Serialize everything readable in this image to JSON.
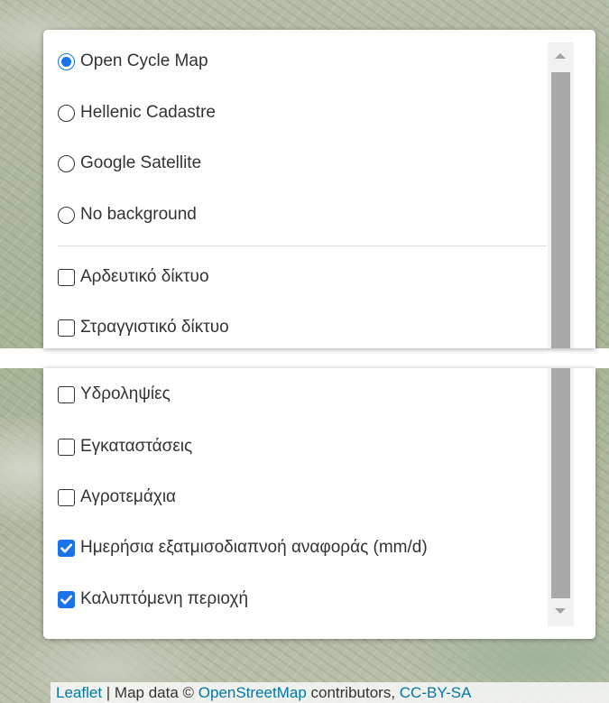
{
  "base_layers": [
    {
      "label": "Open Cycle Map",
      "checked": true
    },
    {
      "label": "Hellenic Cadastre",
      "checked": false
    },
    {
      "label": "Google Satellite",
      "checked": false
    },
    {
      "label": "No background",
      "checked": false
    }
  ],
  "overlays_top": [
    {
      "label": "Αρδευτικό δίκτυο",
      "checked": false
    },
    {
      "label": "Στραγγιστικό δίκτυο",
      "checked": false
    }
  ],
  "overlays_bottom": [
    {
      "label": "Υδροληψίες",
      "checked": false
    },
    {
      "label": "Εγκαταστάσεις",
      "checked": false
    },
    {
      "label": "Αγροτεμάχια",
      "checked": false
    },
    {
      "label": "Ημερήσια εξατμισοδιαπνοή αναφοράς (mm/d)",
      "checked": true
    },
    {
      "label": "Καλυπτόμενη περιοχή",
      "checked": true
    }
  ],
  "attribution": {
    "leaflet": "Leaflet",
    "sep1": " | Map data © ",
    "osm": "OpenStreetMap",
    "contributors": " contributors, ",
    "license": "CC-BY-SA"
  },
  "colors": {
    "accent": "#1a73e8",
    "link": "#0078a8"
  }
}
